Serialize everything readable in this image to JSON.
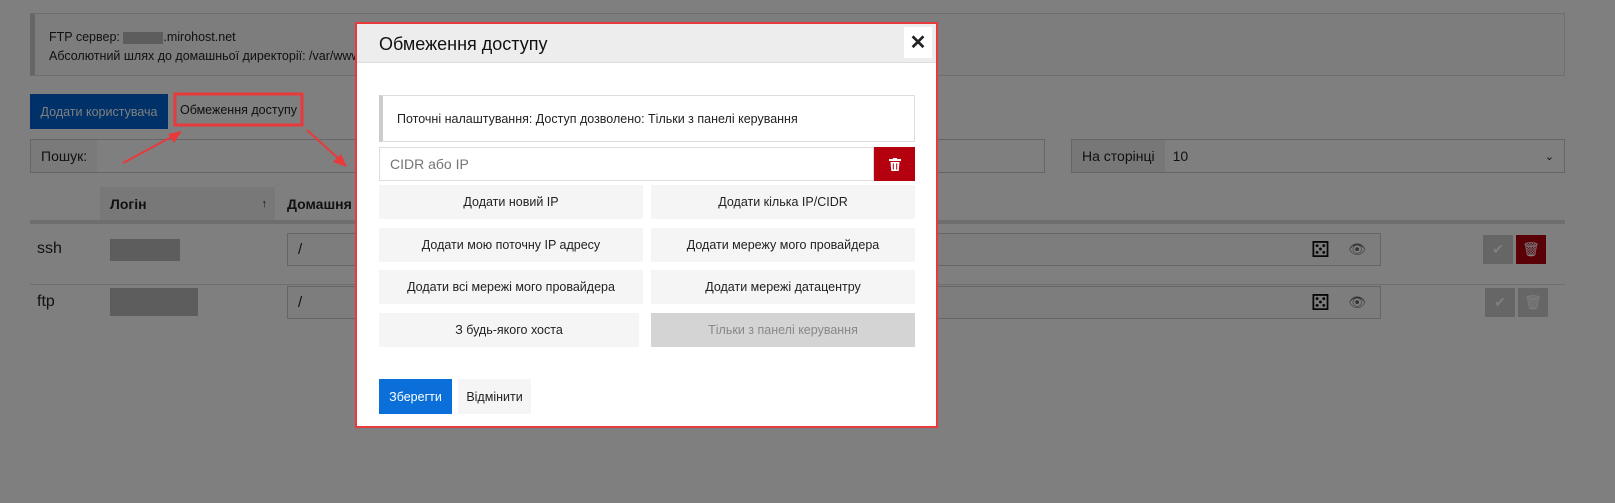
{
  "page": {
    "ftp_server_label": "FTP сервер:",
    "ftp_server_suffix": ".mirohost.net",
    "home_path_text": "Абсолютний шлях до домашньої директорії: /var/www",
    "add_user_label": "Додати користувача",
    "access_restriction_label": "Обмеження доступу",
    "search_label": "Пошук:",
    "per_page_label": "На сторінці",
    "per_page_value": "10",
    "table": {
      "columns": [
        "Логін",
        "Домашня"
      ],
      "sort_indicator": "↑",
      "rows": [
        {
          "type": "ssh",
          "home": "/"
        },
        {
          "type": "ftp",
          "home": "/"
        }
      ]
    }
  },
  "modal": {
    "title": "Обмеження доступу",
    "close": "✕",
    "current_settings": "Поточні налаштування: Доступ дозволено: Тільки з панелі керування",
    "cidr_placeholder": "CIDR або IP",
    "options": [
      {
        "label": "Додати новий IP",
        "disabled": false
      },
      {
        "label": "Додати кілька IP/CIDR",
        "disabled": false
      },
      {
        "label": "Додати мою поточну IP адресу",
        "disabled": false
      },
      {
        "label": "Додати мережу мого провайдера",
        "disabled": false
      },
      {
        "label": "Додати всі мережі мого провайдера",
        "disabled": false
      },
      {
        "label": "Додати мережі датацентру",
        "disabled": false
      },
      {
        "label": "З будь-якого хоста",
        "disabled": false
      },
      {
        "label": "Тільки з панелі керування",
        "disabled": true
      }
    ],
    "save_label": "Зберегти",
    "cancel_label": "Відмінити"
  },
  "colors": {
    "primary": "#0a6fd8",
    "danger": "#b5000f",
    "annotation": "#e8393b"
  }
}
